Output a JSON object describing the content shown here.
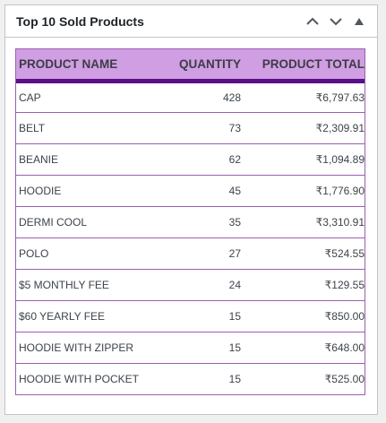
{
  "widget": {
    "title": "Top 10 Sold Products"
  },
  "table": {
    "headers": {
      "name": "PRODUCT NAME",
      "quantity": "QUANTITY",
      "total": "PRODUCT TOTAL"
    },
    "rows": [
      {
        "name": "CAP",
        "quantity": "428",
        "total": "₹6,797.63"
      },
      {
        "name": "BELT",
        "quantity": "73",
        "total": "₹2,309.91"
      },
      {
        "name": "BEANIE",
        "quantity": "62",
        "total": "₹1,094.89"
      },
      {
        "name": "HOODIE",
        "quantity": "45",
        "total": "₹1,776.90"
      },
      {
        "name": "DERMI COOL",
        "quantity": "35",
        "total": "₹3,310.91"
      },
      {
        "name": "POLO",
        "quantity": "27",
        "total": "₹524.55"
      },
      {
        "name": "$5 MONTHLY FEE",
        "quantity": "24",
        "total": "₹129.55"
      },
      {
        "name": "$60 YEARLY FEE",
        "quantity": "15",
        "total": "₹850.00"
      },
      {
        "name": "HOODIE WITH ZIPPER",
        "quantity": "15",
        "total": "₹648.00"
      },
      {
        "name": "HOODIE WITH POCKET",
        "quantity": "15",
        "total": "₹525.00"
      }
    ]
  },
  "icons": {
    "move_up": "chevron-up-icon",
    "move_down": "chevron-down-icon",
    "toggle": "triangle-up-icon"
  },
  "colors": {
    "header_bg": "#d09ee2",
    "header_border": "#5b0f87",
    "row_border": "#9c5fb1"
  }
}
